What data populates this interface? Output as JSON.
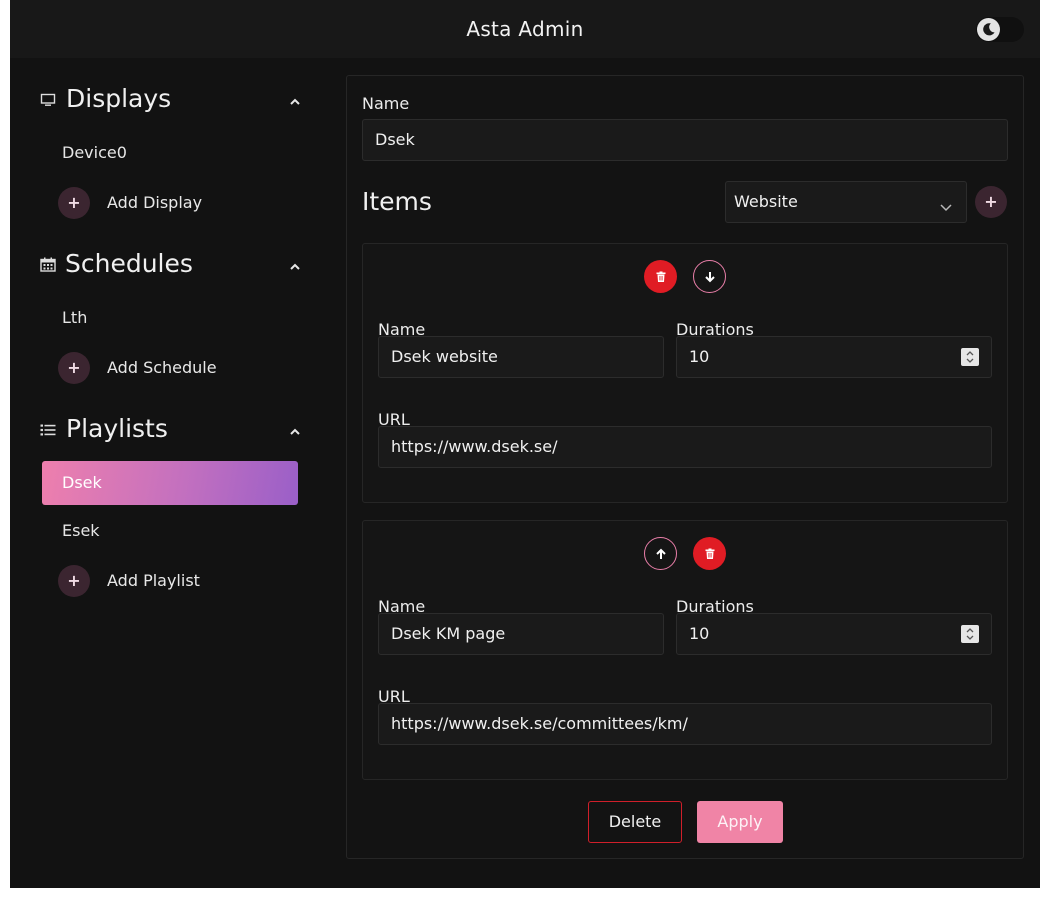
{
  "header": {
    "title": "Asta Admin",
    "theme_toggle_icon": "moon-icon"
  },
  "sidebar": {
    "displays": {
      "title": "Displays",
      "icon": "monitor-icon",
      "items": [
        "Device0"
      ],
      "add_label": "Add Display"
    },
    "schedules": {
      "title": "Schedules",
      "icon": "calendar-icon",
      "items": [
        "Lth"
      ],
      "add_label": "Add Schedule"
    },
    "playlists": {
      "title": "Playlists",
      "icon": "list-icon",
      "items": [
        "Dsek",
        "Esek"
      ],
      "active": "Dsek",
      "add_label": "Add Playlist"
    }
  },
  "main": {
    "name_label": "Name",
    "name_value": "Dsek",
    "items_title": "Items",
    "item_type_selected": "Website",
    "items": [
      {
        "name_label": "Name",
        "name_value": "Dsek website",
        "duration_label": "Durations",
        "duration_value": "10",
        "url_label": "URL",
        "url_value": "https://www.dsek.se/"
      },
      {
        "name_label": "Name",
        "name_value": "Dsek KM page",
        "duration_label": "Durations",
        "duration_value": "10",
        "url_label": "URL",
        "url_value": "https://www.dsek.se/committees/km/"
      }
    ],
    "delete_label": "Delete",
    "apply_label": "Apply"
  },
  "colors": {
    "background": "#121212",
    "accent_pink": "#f084a6",
    "danger_red": "#e01c24",
    "active_gradient_start": "#ee7fad",
    "active_gradient_end": "#9a5fc8"
  }
}
